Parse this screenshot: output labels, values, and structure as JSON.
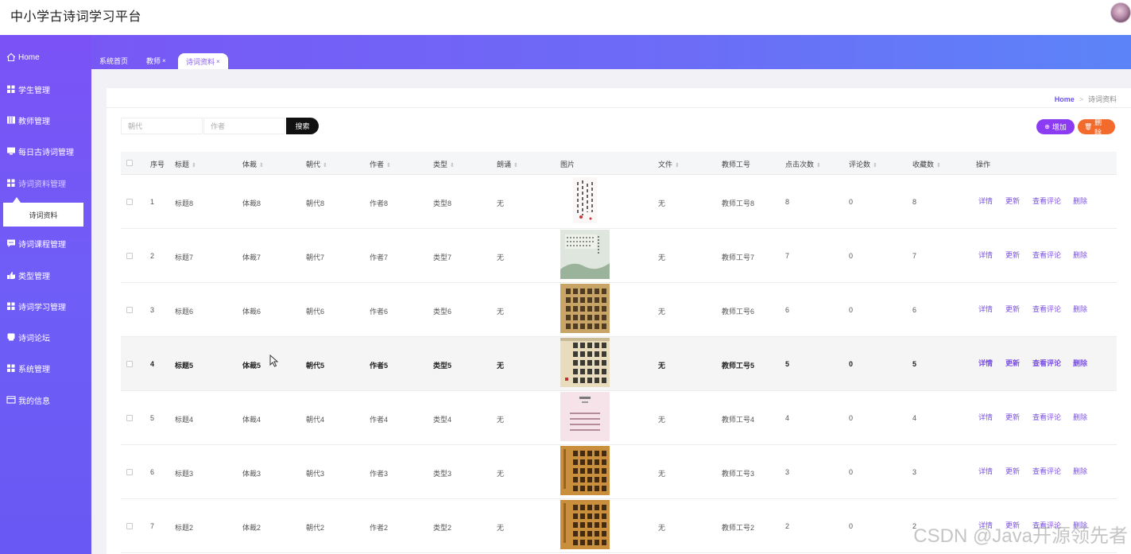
{
  "app": {
    "title": "中小学古诗词学习平台"
  },
  "sidebar": {
    "items": [
      {
        "label": "Home",
        "icon": "home-icon"
      },
      {
        "label": "学生管理",
        "icon": "grid-icon"
      },
      {
        "label": "教师管理",
        "icon": "book-icon"
      },
      {
        "label": "每日古诗词管理",
        "icon": "monitor-icon"
      },
      {
        "label": "诗词资料管理",
        "icon": "grid-icon"
      },
      {
        "label": "诗词课程管理",
        "icon": "chat-icon"
      },
      {
        "label": "类型管理",
        "icon": "hand-icon"
      },
      {
        "label": "诗词学习管理",
        "icon": "grid-icon"
      },
      {
        "label": "诗词论坛",
        "icon": "bubble-icon"
      },
      {
        "label": "系统管理",
        "icon": "grid-icon"
      },
      {
        "label": "我的信息",
        "icon": "card-icon"
      }
    ],
    "sub_item": "诗词资料"
  },
  "tabs": [
    {
      "label": "系统首页",
      "close": ""
    },
    {
      "label": "教师",
      "close": "×"
    },
    {
      "label": "诗词资料",
      "close": "×"
    }
  ],
  "breadcrumb": {
    "home": "Home",
    "sep": ">",
    "current": "诗词资料"
  },
  "search": {
    "dynasty_placeholder": "朝代",
    "author_placeholder": "作者",
    "button": "搜索"
  },
  "toolbar": {
    "add_label": "增加",
    "delete_label": "删除"
  },
  "table": {
    "headers": [
      "序号",
      "标题",
      "体裁",
      "朝代",
      "作者",
      "类型",
      "朗诵",
      "图片",
      "文件",
      "教师工号",
      "点击次数",
      "评论数",
      "收藏数",
      "操作"
    ],
    "rows": [
      {
        "no": "1",
        "title": "标题8",
        "genre": "体裁8",
        "dynasty": "朝代8",
        "author": "作者8",
        "type": "类型8",
        "recite": "无",
        "file": "无",
        "teacher": "教师工号8",
        "clicks": "8",
        "comments": "0",
        "favs": "8",
        "image": "calligraphy-white"
      },
      {
        "no": "2",
        "title": "标题7",
        "genre": "体裁7",
        "dynasty": "朝代7",
        "author": "作者7",
        "type": "类型7",
        "recite": "无",
        "file": "无",
        "teacher": "教师工号7",
        "clicks": "7",
        "comments": "0",
        "favs": "7",
        "image": "landscape-green"
      },
      {
        "no": "3",
        "title": "标题6",
        "genre": "体裁6",
        "dynasty": "朝代6",
        "author": "作者6",
        "type": "类型6",
        "recite": "无",
        "file": "无",
        "teacher": "教师工号6",
        "clicks": "6",
        "comments": "0",
        "favs": "6",
        "image": "calligraphy-tan"
      },
      {
        "no": "4",
        "title": "标题5",
        "genre": "体裁5",
        "dynasty": "朝代5",
        "author": "作者5",
        "type": "类型5",
        "recite": "无",
        "file": "无",
        "teacher": "教师工号5",
        "clicks": "5",
        "comments": "0",
        "favs": "5",
        "image": "calligraphy-cream"
      },
      {
        "no": "5",
        "title": "标题4",
        "genre": "体裁4",
        "dynasty": "朝代4",
        "author": "作者4",
        "type": "类型4",
        "recite": "无",
        "file": "无",
        "teacher": "教师工号4",
        "clicks": "4",
        "comments": "0",
        "favs": "4",
        "image": "poem-pink"
      },
      {
        "no": "6",
        "title": "标题3",
        "genre": "体裁3",
        "dynasty": "朝代3",
        "author": "作者3",
        "type": "类型3",
        "recite": "无",
        "file": "无",
        "teacher": "教师工号3",
        "clicks": "3",
        "comments": "0",
        "favs": "3",
        "image": "calligraphy-orange"
      },
      {
        "no": "7",
        "title": "标题2",
        "genre": "体裁2",
        "dynasty": "朝代2",
        "author": "作者2",
        "type": "类型2",
        "recite": "无",
        "file": "无",
        "teacher": "教师工号2",
        "clicks": "2",
        "comments": "0",
        "favs": "2",
        "image": "calligraphy-orange"
      }
    ],
    "actions": [
      "详情",
      "更新",
      "查看评论",
      "删除"
    ]
  },
  "watermark": "CSDN @Java开源领先者",
  "colors": {
    "accent": "#7c4fe6",
    "sidebar": "#7455f6",
    "add": "#8b3cf2",
    "delete": "#f26a2c"
  }
}
